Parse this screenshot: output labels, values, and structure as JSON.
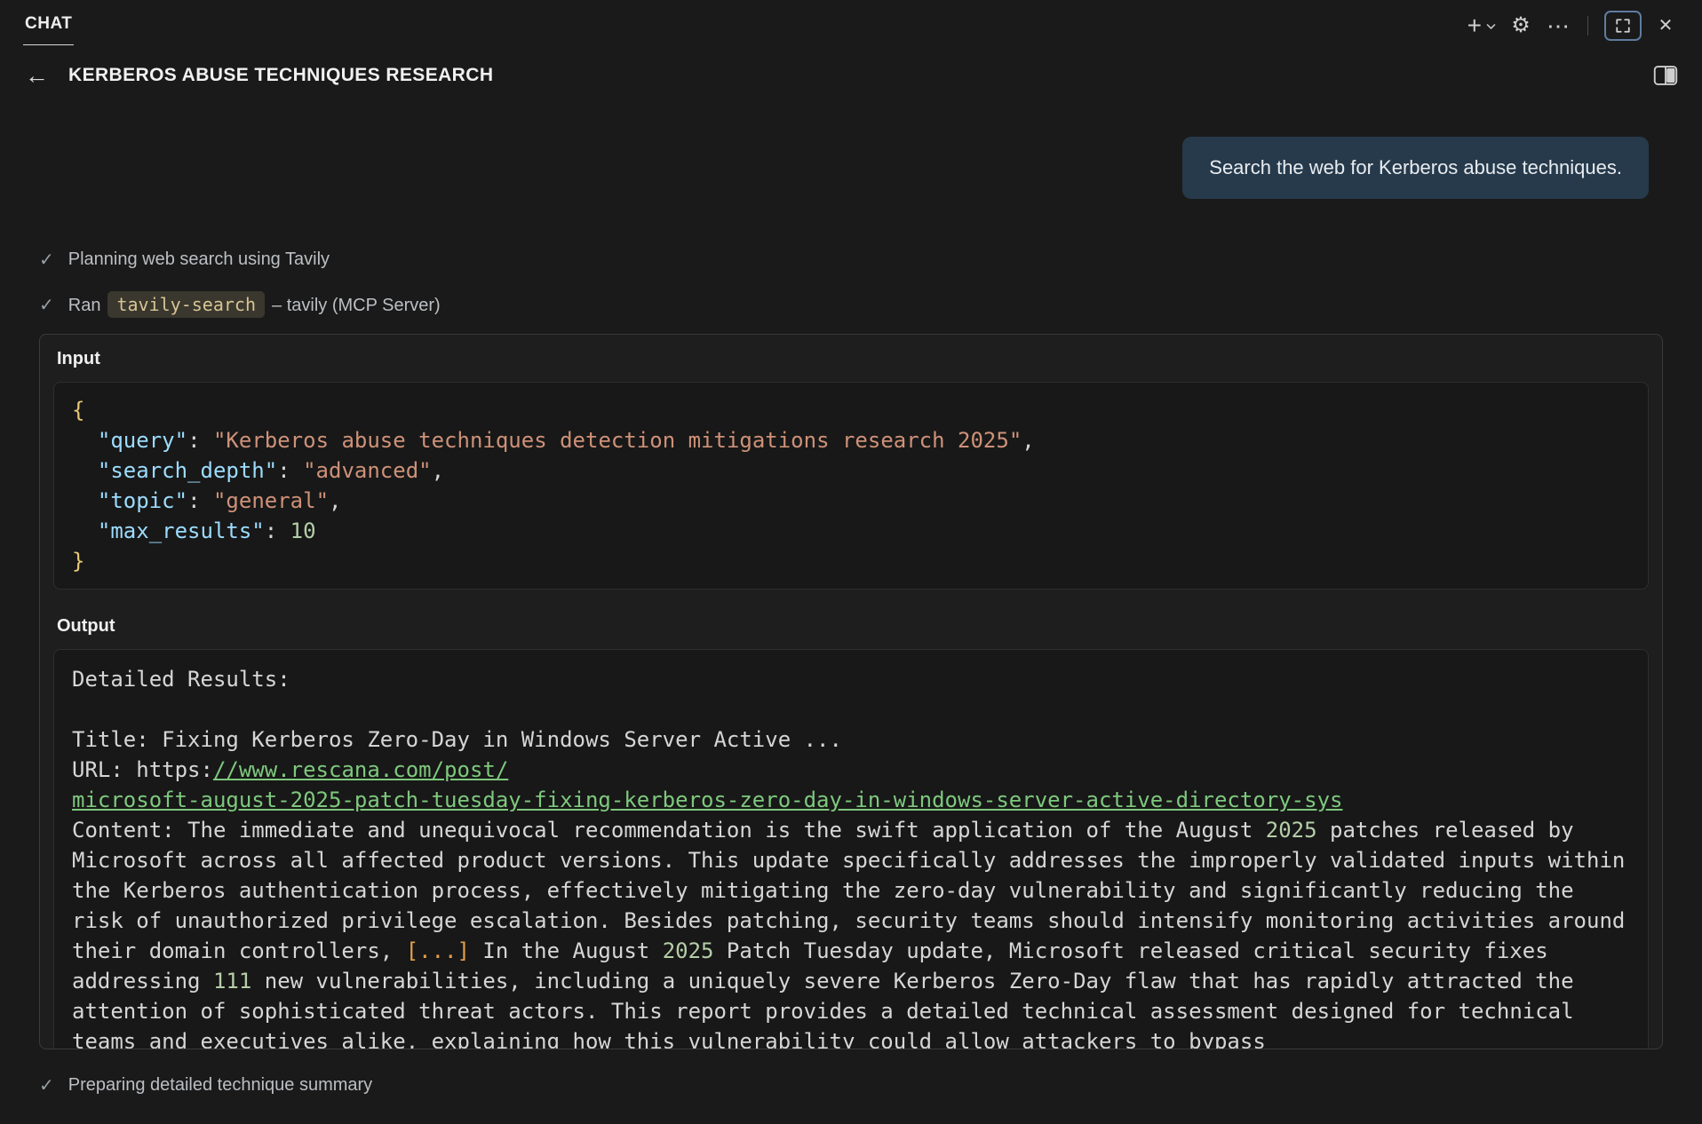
{
  "colors": {
    "background": "#1a1a1a",
    "panel_border": "#3a3a3a",
    "user_bubble_bg": "#273a4b",
    "focus_ring": "#5e7ca0",
    "code_key": "#9cdcfe",
    "code_string": "#ce9178",
    "code_number": "#b5cea8",
    "code_brace": "#e8c878",
    "code_link": "#7ec87e",
    "code_highlight": "#e2a04d"
  },
  "icons": {
    "plus": "+",
    "gear": "⚙",
    "ellipsis": "⋯",
    "close": "✕",
    "check": "✓",
    "back_arrow": "←"
  },
  "topbar": {
    "tab_label": "CHAT"
  },
  "header": {
    "title": "KERBEROS ABUSE TECHNIQUES RESEARCH"
  },
  "chat": {
    "user_message": "Search the web for Kerberos abuse techniques."
  },
  "steps": {
    "planning": "Planning web search using Tavily",
    "ran_prefix": "Ran",
    "ran_chip": "tavily-search",
    "ran_suffix": "– tavily (MCP Server)",
    "final": "Preparing detailed technique summary"
  },
  "tool_call": {
    "input_label": "Input",
    "output_label": "Output",
    "input_segments": [
      {
        "t": "{",
        "c": "brace"
      },
      {
        "t": "\n  "
      },
      {
        "t": "\"query\"",
        "c": "key"
      },
      {
        "t": ": "
      },
      {
        "t": "\"Kerberos abuse techniques detection mitigations research 2025\"",
        "c": "str"
      },
      {
        "t": ",\n  "
      },
      {
        "t": "\"search_depth\"",
        "c": "key"
      },
      {
        "t": ": "
      },
      {
        "t": "\"advanced\"",
        "c": "str"
      },
      {
        "t": ",\n  "
      },
      {
        "t": "\"topic\"",
        "c": "key"
      },
      {
        "t": ": "
      },
      {
        "t": "\"general\"",
        "c": "str"
      },
      {
        "t": ",\n  "
      },
      {
        "t": "\"max_results\"",
        "c": "key"
      },
      {
        "t": ": "
      },
      {
        "t": "10",
        "c": "num"
      },
      {
        "t": "\n"
      },
      {
        "t": "}",
        "c": "brace"
      }
    ],
    "output_segments": [
      {
        "t": "Detailed Results:\n\nTitle: Fixing Kerberos Zero-Day in Windows Server Active ...\nURL: https:"
      },
      {
        "t": "//www.rescana.com/post/\nmicrosoft-august-2025-patch-tuesday-fixing-kerberos-zero-day-in-windows-server-active-directory-sys",
        "c": "link"
      },
      {
        "t": "\nContent: The immediate and unequivocal recommendation is the swift application of the August "
      },
      {
        "t": "2025",
        "c": "num"
      },
      {
        "t": " patches released by Microsoft across all affected product versions. This update specifically addresses the improperly validated inputs within the Kerberos authentication process, effectively mitigating the zero-day vulnerability and significantly reducing the risk of unauthorized privilege escalation. Besides patching, security teams should intensify monitoring activities around their domain controllers, "
      },
      {
        "t": "[...]",
        "c": "hl"
      },
      {
        "t": " In the August "
      },
      {
        "t": "2025",
        "c": "num"
      },
      {
        "t": " Patch Tuesday update, Microsoft released critical security fixes addressing "
      },
      {
        "t": "111",
        "c": "num"
      },
      {
        "t": " new vulnerabilities, including a uniquely severe Kerberos Zero-Day flaw that has rapidly attracted the attention of sophisticated threat actors. This report provides a detailed technical assessment designed for technical teams and executives alike, explaining how this vulnerability could allow attackers to bypass"
      }
    ]
  }
}
